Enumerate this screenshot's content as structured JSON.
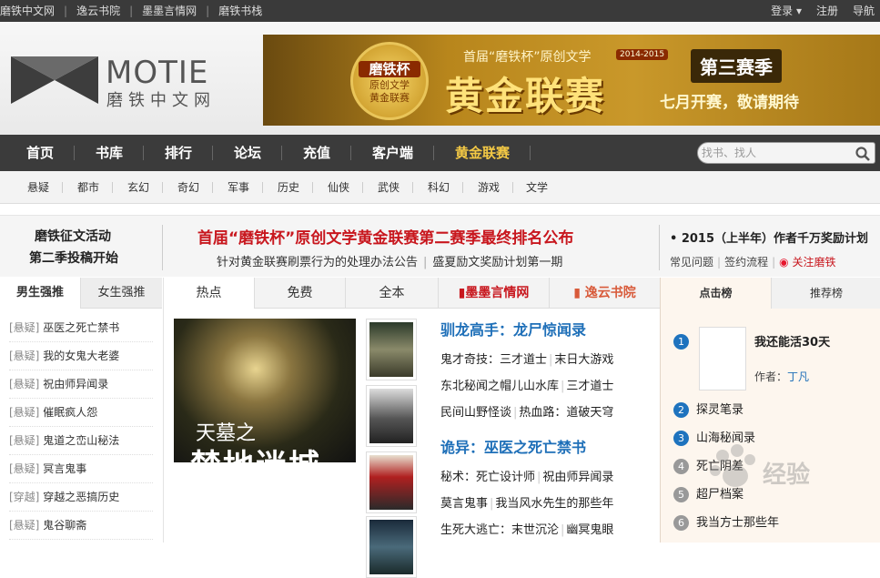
{
  "topbar": {
    "links": [
      "磨铁中文网",
      "逸云书院",
      "墨墨言情网",
      "磨铁书栈"
    ],
    "login": "登录",
    "register": "注册",
    "guide": "导航"
  },
  "logo": {
    "text": "MOTIE",
    "sub": "磨铁中文网"
  },
  "banner": {
    "badge_title": "磨铁杯",
    "badge_line1": "原创文学",
    "badge_line2": "黄金联赛",
    "line1": "首届“磨铁杯”原创文学",
    "year": "2014-2015",
    "main": "黄金联赛",
    "season": "第三赛季",
    "sub": "七月开赛，敬请期待"
  },
  "nav": {
    "items": [
      "首页",
      "书库",
      "排行",
      "论坛",
      "充值",
      "客户端",
      "黄金联赛"
    ],
    "active_color": "#f3c845",
    "search_placeholder": "找书、找人"
  },
  "subnav": [
    "悬疑",
    "都市",
    "玄幻",
    "奇幻",
    "军事",
    "历史",
    "仙侠",
    "武侠",
    "科幻",
    "游戏",
    "文学"
  ],
  "notice": {
    "left1": "磨铁征文活动",
    "left2": "第二季投稿开始",
    "headline": "首届“磨铁杯”原创文学黄金联赛第二赛季最终排名公布",
    "sub1": "针对黄金联赛刷票行为的处理办法公告",
    "sub_sep": "|",
    "sub2": "盛夏励文奖励计划第一期",
    "right1": "• 2015（上半年）作者千万奖励计划",
    "r_faq": "常见问题",
    "r_sep": "|",
    "r_sign": "签约流程",
    "r_follow": "关注磨铁"
  },
  "left": {
    "tabs": [
      "男生强推",
      "女生强推"
    ],
    "items": [
      {
        "cat": "[悬疑]",
        "title": "巫医之死亡禁书"
      },
      {
        "cat": "[悬疑]",
        "title": "我的女鬼大老婆"
      },
      {
        "cat": "[悬疑]",
        "title": "祝由师异闻录"
      },
      {
        "cat": "[悬疑]",
        "title": "催眠疯人怨"
      },
      {
        "cat": "[悬疑]",
        "title": "鬼道之峦山秘法"
      },
      {
        "cat": "[悬疑]",
        "title": "冥言鬼事"
      },
      {
        "cat": "[穿越]",
        "title": "穿越之恶搞历史"
      },
      {
        "cat": "[悬疑]",
        "title": "鬼谷聊斋"
      }
    ]
  },
  "mid": {
    "tabs": [
      "热点",
      "免费",
      "全本",
      "墨墨言情网",
      "逸云书院"
    ],
    "cover_t1": "天墓之",
    "cover_t2": "禁地迷城",
    "heading1": "驯龙高手：龙尸惊闻录",
    "rows1": [
      [
        "鬼才奇技：三才道士",
        "末日大游戏"
      ],
      [
        "东北秘闻之帽儿山水库",
        "三才道士"
      ],
      [
        "民间山野怪谈",
        "热血路：道破天穹"
      ]
    ],
    "heading2": "诡异：巫医之死亡禁书",
    "rows2": [
      [
        "秘术：死亡设计师",
        "祝由师异闻录"
      ],
      [
        "莫言鬼事",
        "我当风水先生的那些年"
      ],
      [
        "生死大逃亡：末世沉沦",
        "幽冥鬼眼"
      ]
    ]
  },
  "right": {
    "tabs": [
      "点击榜",
      "推荐榜"
    ],
    "first_title": "我还能活30天",
    "author_label": "作者：",
    "author": "丁凡",
    "ranks": [
      {
        "n": "1",
        "title": "我还能活30天"
      },
      {
        "n": "2",
        "title": "探灵笔录"
      },
      {
        "n": "3",
        "title": "山海秘闻录"
      },
      {
        "n": "4",
        "title": "死亡阴差"
      },
      {
        "n": "5",
        "title": "超尸档案"
      },
      {
        "n": "6",
        "title": "我当方士那些年"
      }
    ],
    "watermark": "经验"
  }
}
